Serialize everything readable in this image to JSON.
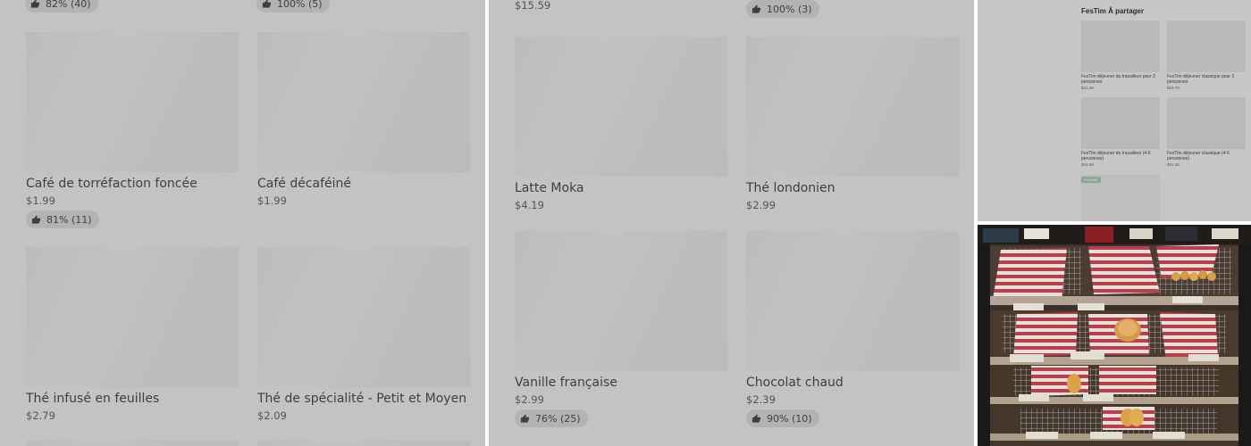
{
  "panel1": {
    "top_ratings": [
      "82% (40)",
      "100% (5)"
    ],
    "items": [
      {
        "name": "Café de torréfaction foncée",
        "price": "$1.99",
        "rating": "81% (11)"
      },
      {
        "name": "Café décaféiné",
        "price": "$1.99"
      },
      {
        "name": "Thé infusé en feuilles",
        "price": "$2.79"
      },
      {
        "name": "Thé de spécialité - Petit et Moyen",
        "price": "$2.09"
      }
    ]
  },
  "panel2": {
    "top_price": "$15.59",
    "top_rating": "100% (3)",
    "items": [
      {
        "name": "Latte Moka",
        "price": "$4.19"
      },
      {
        "name": "Thé londonien",
        "price": "$2.99"
      },
      {
        "name": "Vanille française",
        "price": "$2.99",
        "rating": "76% (25)"
      },
      {
        "name": "Chocolat chaud",
        "price": "$2.39",
        "rating": "90% (10)"
      }
    ]
  },
  "panel3": {
    "title": "FesTim Â partager",
    "items": [
      {
        "name": "FesTim déjeuner du travailleur pour 2 personnes",
        "price": "$21.29"
      },
      {
        "name": "FesTim déjeuner classique pour 2 personnes",
        "price": "$19.79"
      },
      {
        "name": "FesTim déjeuner du travailleur (4-6 personnes)",
        "price": "$44.09"
      },
      {
        "name": "FesTim déjeuner classique (4-6 personnes)",
        "price": "$41.15"
      }
    ],
    "badge": "Popular"
  },
  "icons": {
    "thumb": "thumbs-up-icon"
  },
  "colors": {
    "overlay": "#c3c3c3",
    "badge": "#3e8e5e",
    "pastry_paper": "#c8414a"
  }
}
